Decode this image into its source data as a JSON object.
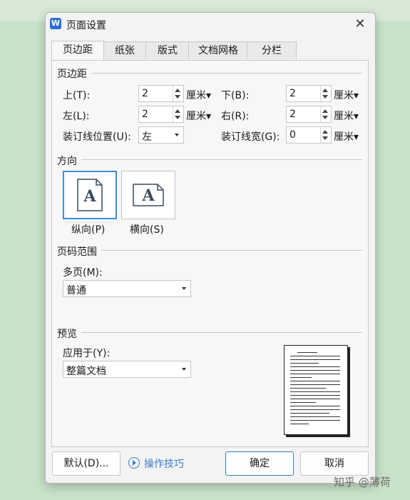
{
  "dialog": {
    "title": "页面设置",
    "app_icon_letter": "W",
    "close": "✕"
  },
  "tabs": [
    "页边距",
    "纸张",
    "版式",
    "文档网格",
    "分栏"
  ],
  "margins": {
    "section_title": "页边距",
    "top_label": "上(T):",
    "top_value": "2",
    "bottom_label": "下(B):",
    "bottom_value": "2",
    "left_label": "左(L):",
    "left_value": "2",
    "right_label": "右(R):",
    "right_value": "2",
    "gutter_pos_label": "装订线位置(U):",
    "gutter_pos_value": "左",
    "gutter_width_label": "装订线宽(G):",
    "gutter_width_value": "0",
    "unit": "厘米"
  },
  "orientation": {
    "section_title": "方向",
    "glyph": "A",
    "portrait_label": "纵向(P)",
    "landscape_label": "横向(S)",
    "selected": "portrait"
  },
  "page_range": {
    "section_title": "页码范围",
    "multi_label": "多页(M):",
    "multi_value": "普通"
  },
  "preview": {
    "section_title": "预览",
    "apply_label": "应用于(Y):",
    "apply_value": "整篇文档"
  },
  "buttons": {
    "default": "默认(D)...",
    "tips": "操作技巧",
    "ok": "确定",
    "cancel": "取消"
  },
  "watermark": "知乎 @薄荷",
  "colors": {
    "accent": "#3a7bc8",
    "background": "#c9e2c9"
  }
}
